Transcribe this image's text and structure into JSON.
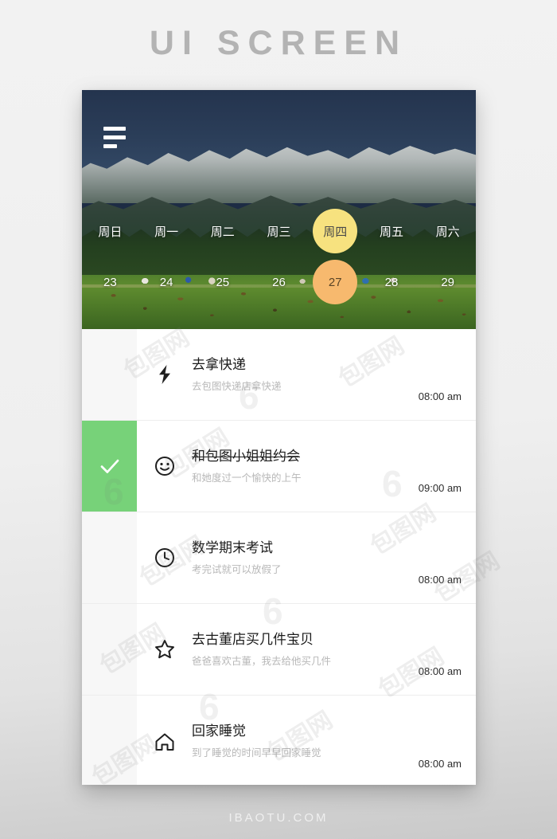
{
  "page": {
    "title": "UI SCREEN",
    "footer": "IBAOTU.COM",
    "watermark": "包图网",
    "watermark_mark": "6"
  },
  "header": {
    "menu_icon": "hamburger-icon"
  },
  "calendar": {
    "days": [
      {
        "label": "周日",
        "date": "23",
        "active": false
      },
      {
        "label": "周一",
        "date": "24",
        "active": false
      },
      {
        "label": "周二",
        "date": "25",
        "active": false
      },
      {
        "label": "周三",
        "date": "26",
        "active": false
      },
      {
        "label": "周四",
        "date": "27",
        "active": true
      },
      {
        "label": "周五",
        "date": "28",
        "active": false
      },
      {
        "label": "周六",
        "date": "29",
        "active": false
      }
    ],
    "day_highlight_color": "#F7E27F",
    "date_highlight_color": "#F7B96E"
  },
  "tasks": [
    {
      "icon": "lightning-bolt-icon",
      "title": "去拿快递",
      "subtitle": "去包图快递店拿快递",
      "time": "08:00 am",
      "done": false
    },
    {
      "icon": "smiley-face-icon",
      "title": "和包图小姐姐约会",
      "subtitle": "和她度过一个愉快的上午",
      "time": "09:00 am",
      "done": true
    },
    {
      "icon": "clock-icon",
      "title": "数学期末考试",
      "subtitle": "考完试就可以放假了",
      "time": "08:00 am",
      "done": false
    },
    {
      "icon": "star-icon",
      "title": "去古董店买几件宝贝",
      "subtitle": "爸爸喜欢古董，我去给他买几件",
      "time": "08:00 am",
      "done": false
    },
    {
      "icon": "home-icon",
      "title": "回家睡觉",
      "subtitle": "到了睡觉的时间早早回家睡觉",
      "time": "08:00 am",
      "done": false
    }
  ],
  "colors": {
    "done_green": "#77D279",
    "strip_gray": "#F7F7F7",
    "card_white": "#FFFFFF"
  }
}
